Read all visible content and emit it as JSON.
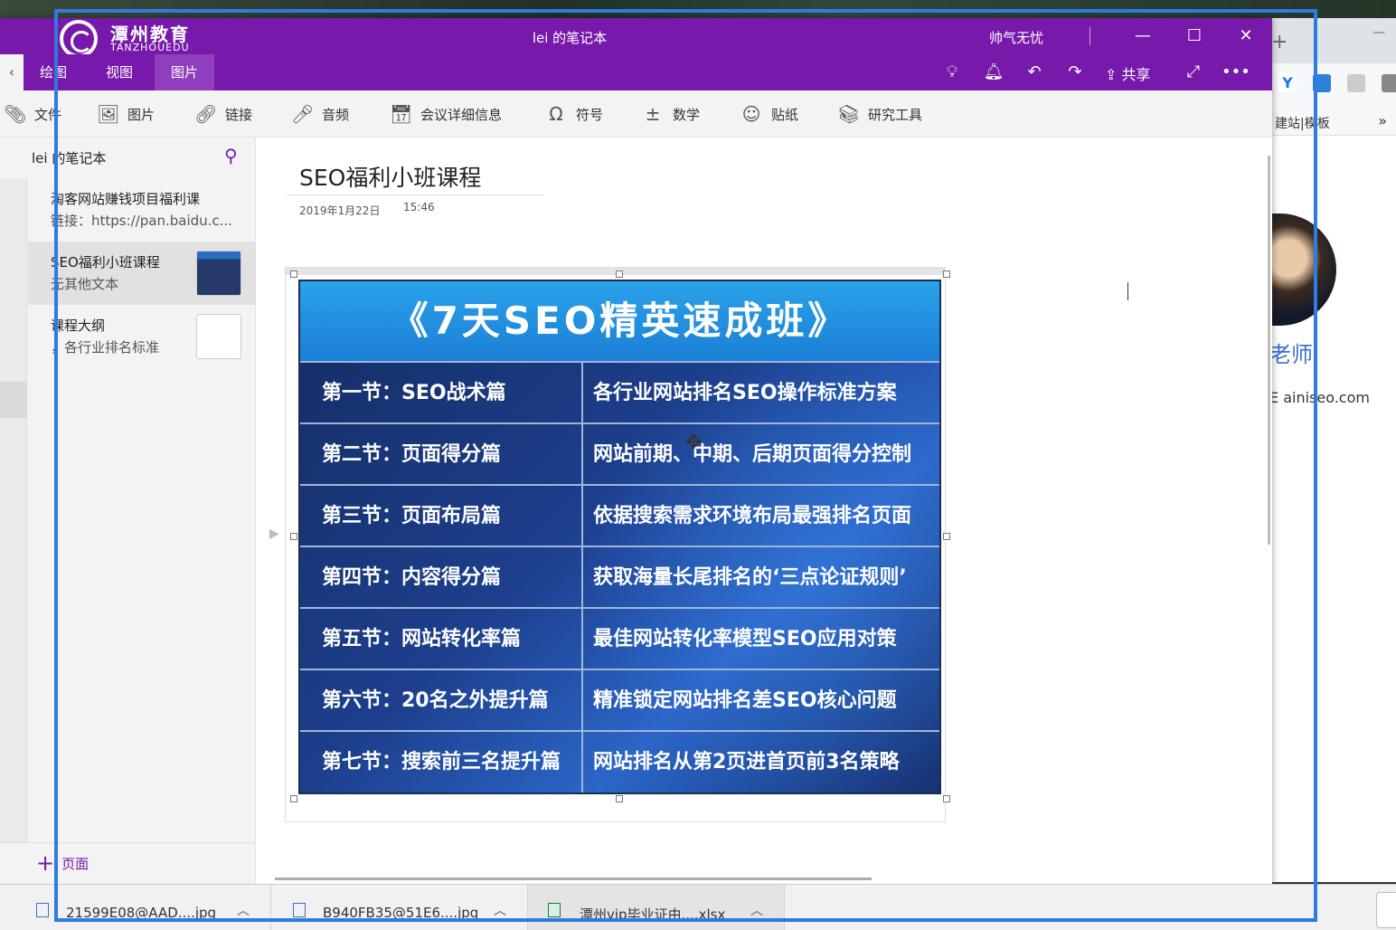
{
  "onenote": {
    "logo": {
      "cn": "潭州教育",
      "en": "TANZHOUEDU"
    },
    "window_title": "lei 的笔记本",
    "user_name": "帅气无忧",
    "menu_tabs": [
      {
        "label": "绘图"
      },
      {
        "label": "视图"
      },
      {
        "label": "图片"
      }
    ],
    "share_label": "共享",
    "ribbon": [
      {
        "label": "文件",
        "icon": "paperclip-icon"
      },
      {
        "label": "图片",
        "icon": "picture-icon"
      },
      {
        "label": "链接",
        "icon": "link-icon"
      },
      {
        "label": "音频",
        "icon": "audio-record-icon"
      },
      {
        "label": "会议详细信息",
        "icon": "calendar-icon"
      },
      {
        "label": "符号",
        "icon": "omega-icon"
      },
      {
        "label": "数学",
        "icon": "math-icon"
      },
      {
        "label": "贴纸",
        "icon": "smiley-icon"
      },
      {
        "label": "研究工具",
        "icon": "research-icon"
      }
    ],
    "notebook_name": "lei 的笔记本",
    "pages": [
      {
        "title": "淘客网站赚钱项目福利课",
        "subtitle": "链接：https://pan.baidu.c..."
      },
      {
        "title": "SEO福利小班课程",
        "subtitle": "无其他文本"
      },
      {
        "title": "课程大纲",
        "subtitle": "，各行业排名标准"
      }
    ],
    "add_page_label": "页面",
    "page": {
      "title": "SEO福利小班课程",
      "date": "2019年1月22日",
      "time": "15:46"
    },
    "seo_image": {
      "header": "《7天SEO精英速成班》",
      "rows": [
        {
          "section": "第一节：SEO战术篇",
          "desc": "各行业网站排名SEO操作标准方案"
        },
        {
          "section": "第二节：页面得分篇",
          "desc": "网站前期、中期、后期页面得分控制"
        },
        {
          "section": "第三节：页面布局篇",
          "desc": "依据搜索需求环境布局最强排名页面"
        },
        {
          "section": "第四节：内容得分篇",
          "desc": "获取海量长尾排名的‘三点论证规则’"
        },
        {
          "section": "第五节：网站转化率篇",
          "desc": "最佳网站转化率模型SEO应用对策"
        },
        {
          "section": "第六节：20名之外提升篇",
          "desc": "精准锁定网站排名差SEO核心问题"
        },
        {
          "section": "第七节：搜索前三名提升篇",
          "desc": "网站排名从第2页进首页前3名策略"
        }
      ]
    }
  },
  "background_browser": {
    "bookmark_text": "建站|模板",
    "more": "»",
    "teacher_name": "老师",
    "site_text": "E ainiseo.com"
  },
  "downloads": [
    {
      "name": "21599E08@AAD....jpg",
      "type": "jpg"
    },
    {
      "name": "B940FB35@51E6....jpg",
      "type": "jpg"
    },
    {
      "name": "潭州vip毕业证由....xlsx",
      "type": "xlsx"
    }
  ],
  "colors": {
    "accent": "#7719aa",
    "record_frame": "#2f7be0"
  }
}
